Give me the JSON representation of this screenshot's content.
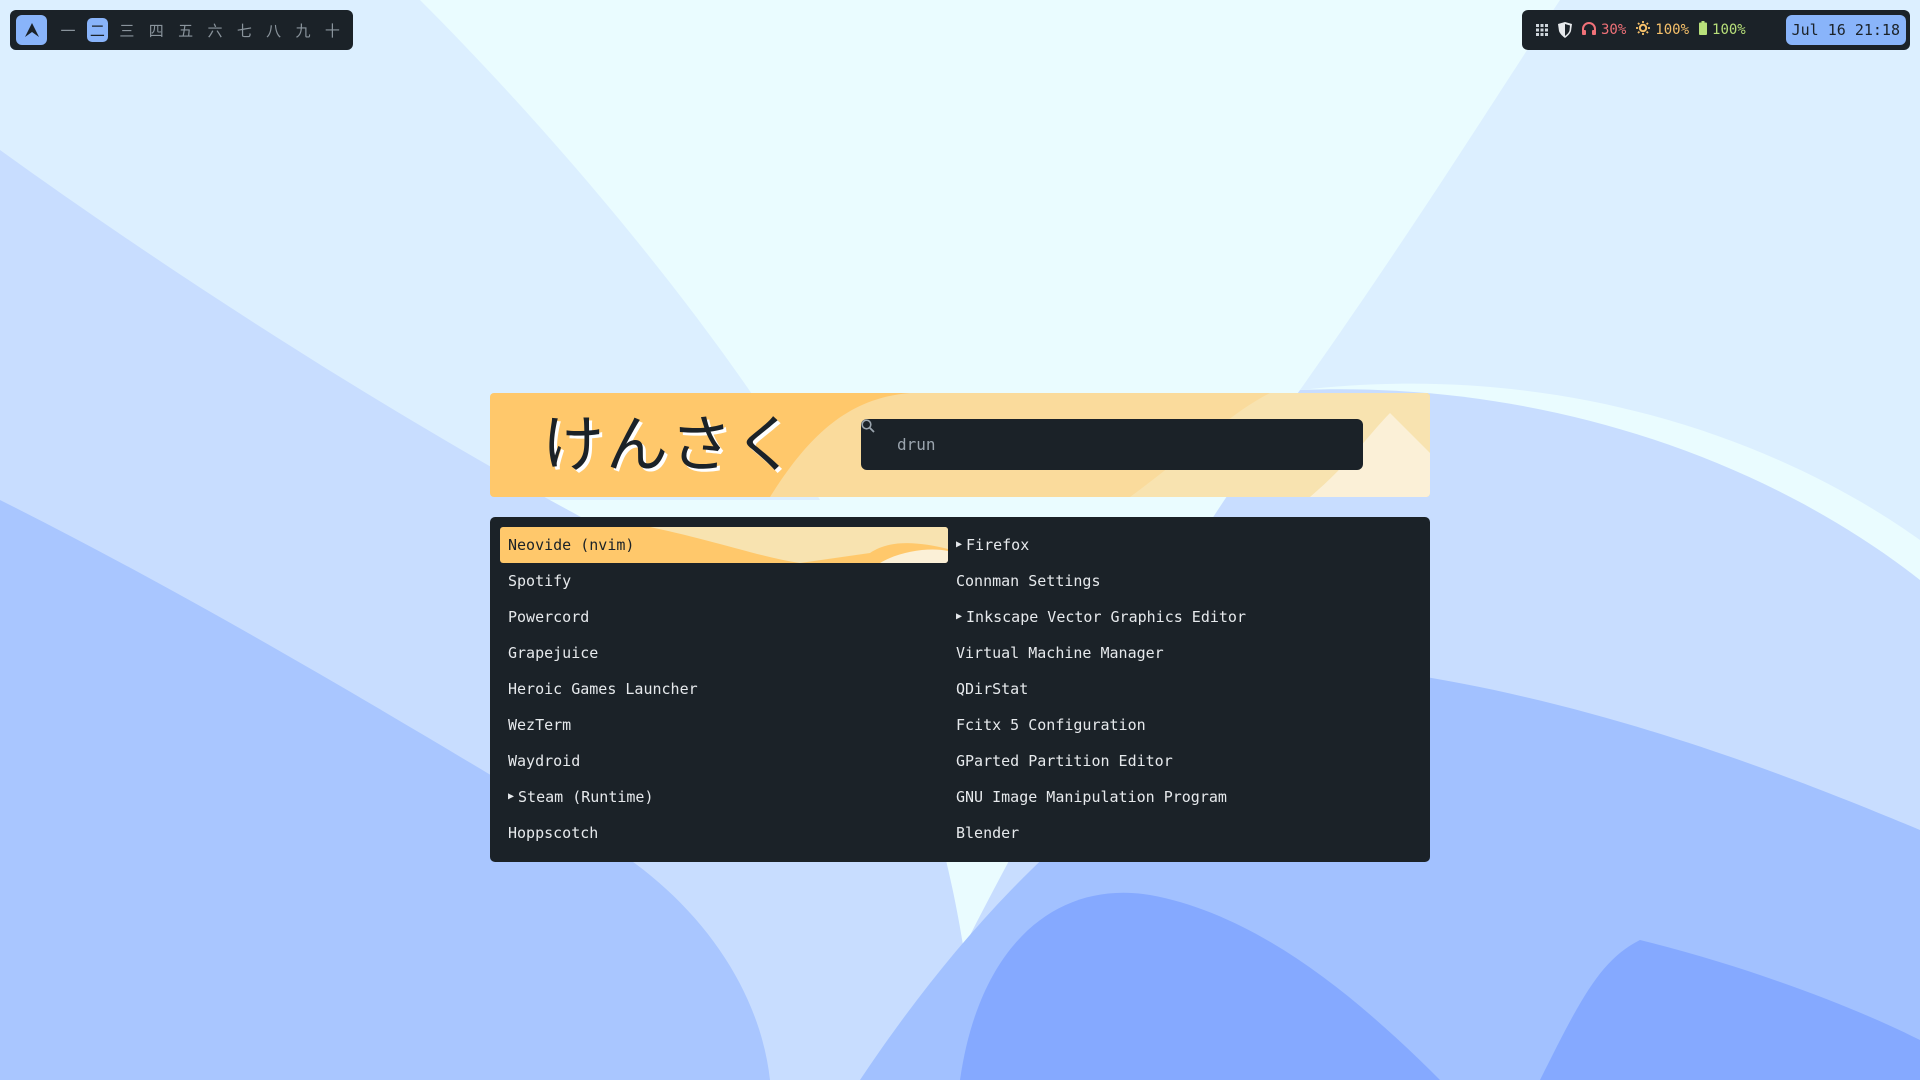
{
  "topbar": {
    "workspaces": [
      "一",
      "二",
      "三",
      "四",
      "五",
      "六",
      "七",
      "八",
      "九",
      "十"
    ],
    "active_workspace": "二",
    "logo_icon": "launcher-logo-icon",
    "accent": "#89b4fa",
    "bg": "#1b2228"
  },
  "status": {
    "icons": [
      "grid-icon",
      "shield-icon",
      "headphones-icon",
      "brightness-icon",
      "battery-icon"
    ],
    "volume": "30%",
    "brightness": "100%",
    "battery": "100%",
    "clock": "Jul 16 21:18"
  },
  "launcher": {
    "prompt": "けんさく",
    "search_value": "drun",
    "search_icon": "search-icon",
    "left_items": [
      {
        "label": "Neovide (nvim)",
        "submenu": false
      },
      {
        "label": "Spotify",
        "submenu": false
      },
      {
        "label": "Powercord",
        "submenu": false
      },
      {
        "label": "Grapejuice",
        "submenu": false
      },
      {
        "label": "Heroic Games Launcher",
        "submenu": false
      },
      {
        "label": "WezTerm",
        "submenu": false
      },
      {
        "label": "Waydroid",
        "submenu": false
      },
      {
        "label": "Steam (Runtime)",
        "submenu": true
      },
      {
        "label": "Hoppscotch",
        "submenu": false
      }
    ],
    "right_items": [
      {
        "label": "Firefox",
        "submenu": true
      },
      {
        "label": "Connman Settings",
        "submenu": false
      },
      {
        "label": "Inkscape Vector Graphics Editor",
        "submenu": true
      },
      {
        "label": "Virtual Machine Manager",
        "submenu": false
      },
      {
        "label": "QDirStat",
        "submenu": false
      },
      {
        "label": "Fcitx 5 Configuration",
        "submenu": false
      },
      {
        "label": "GParted Partition Editor",
        "submenu": false
      },
      {
        "label": "GNU Image Manipulation Program",
        "submenu": false
      },
      {
        "label": "Blender",
        "submenu": false
      }
    ],
    "selected": "Neovide (nvim)",
    "highlight_colors": [
      "#ffc86b",
      "#f8e3b0"
    ]
  }
}
